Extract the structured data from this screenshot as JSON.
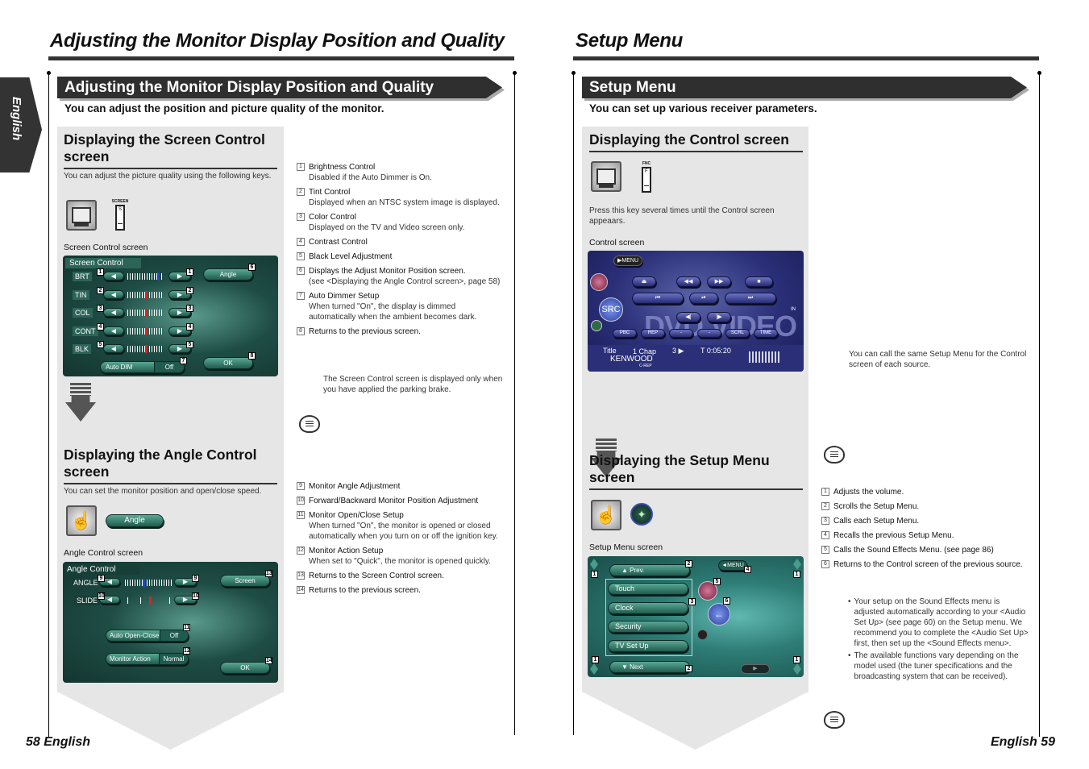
{
  "left_page": {
    "title": "Adjusting the Monitor Display Position and Quality",
    "side_tab": "English",
    "banner": "Adjusting the Monitor Display Position and Quality",
    "lead": "You can adjust the position and picture quality of the monitor.",
    "section1": {
      "heading": "Displaying the Screen Control screen",
      "intro": "You can adjust the picture quality using the following keys.",
      "key_label": "SCREEN",
      "key_letter": "S",
      "caption": "Screen Control screen",
      "screen": {
        "title": "Screen Control",
        "rows": [
          {
            "label": "BRT",
            "num": "1",
            "level": 0.85,
            "marker_color": "#2244cc"
          },
          {
            "label": "TIN",
            "num": "2",
            "level": 0.5,
            "marker_color": "#dd2222"
          },
          {
            "label": "COL",
            "num": "3",
            "level": 0.5,
            "marker_color": "#dd2222"
          },
          {
            "label": "CONT",
            "num": "4",
            "level": 0.5,
            "marker_color": "#dd2222"
          },
          {
            "label": "BLK",
            "num": "5",
            "level": 0.5,
            "marker_color": "#dd2222"
          }
        ],
        "angle_button": "Angle",
        "angle_num": "6",
        "auto_dim_label": "Auto DIM",
        "auto_dim_value": "Off",
        "auto_dim_num": "7",
        "ok_button": "OK",
        "ok_num": "8"
      },
      "items": [
        {
          "num": "1",
          "title": "Brightness Control",
          "desc": "Disabled if the Auto Dimmer is On."
        },
        {
          "num": "2",
          "title": "Tint Control",
          "desc": "Displayed when an NTSC system image is displayed."
        },
        {
          "num": "3",
          "title": "Color Control",
          "desc": "Displayed on the TV and Video screen only."
        },
        {
          "num": "4",
          "title": "Contrast Control",
          "desc": ""
        },
        {
          "num": "5",
          "title": "Black Level Adjustment",
          "desc": ""
        },
        {
          "num": "6",
          "title": "Displays the Adjust Monitor Position screen.",
          "desc": "(see <Displaying the Angle Control screen>, page 58)"
        },
        {
          "num": "7",
          "title": "Auto Dimmer Setup",
          "desc": "When turned \"On\", the display is dimmed automatically when the ambient becomes dark."
        },
        {
          "num": "8",
          "title": "Returns to the previous screen.",
          "desc": ""
        }
      ],
      "note": "The Screen Control screen is displayed only when you have applied the parking brake."
    },
    "section2": {
      "heading": "Displaying the Angle Control screen",
      "intro": "You can set the monitor position and open/close speed.",
      "key_button": "Angle",
      "caption": "Angle Control screen",
      "screen": {
        "title": "Angle Control",
        "angle_label": "ANGLE",
        "angle_num": "9",
        "angle_level": 0.4,
        "slide_label": "SLIDE",
        "slide_num": "10",
        "slide_level": 0.5,
        "screen_button": "Screen",
        "screen_num": "13",
        "auto_open_label": "Auto Open-Close",
        "auto_open_value": "Off",
        "auto_open_num": "11",
        "monitor_action_label": "Monitor Action",
        "monitor_action_value": "Normal",
        "monitor_action_num": "12",
        "ok_button": "OK",
        "ok_num": "14"
      },
      "items": [
        {
          "num": "9",
          "title": "Monitor Angle Adjustment",
          "desc": ""
        },
        {
          "num": "10",
          "title": "Forward/Backward Monitor Position Adjustment",
          "desc": ""
        },
        {
          "num": "11",
          "title": "Monitor Open/Close Setup",
          "desc": "When turned \"On\", the monitor is opened or closed automatically when you turn on or off the ignition key."
        },
        {
          "num": "12",
          "title": "Monitor Action Setup",
          "desc": "When set to \"Quick\", the monitor is opened quickly."
        },
        {
          "num": "13",
          "title": "Returns to the Screen Control screen.",
          "desc": ""
        },
        {
          "num": "14",
          "title": "Returns to the previous screen.",
          "desc": ""
        }
      ]
    },
    "footer": "58 English"
  },
  "right_page": {
    "title": "Setup Menu",
    "banner": "Setup Menu",
    "lead": "You can set up various receiver parameters.",
    "section1": {
      "heading": "Displaying the Control screen",
      "key_label": "FNC",
      "key_letter": "F",
      "intro": "Press this key several times until the Control screen appeaars.",
      "caption": "Control screen",
      "screen": {
        "menu_button": "▶MENU",
        "src_button": "SRC",
        "watermark": "DVD VIDEO",
        "in_label": "IN",
        "small_buttons": [
          "PBC",
          "REP",
          "-",
          "-",
          "SCRL",
          "TIME"
        ],
        "title_label": "Title",
        "chap": "1 Chap",
        "track": "3",
        "time": "T 0:05:20",
        "brand": "KENWOOD",
        "crep": "C-REP"
      },
      "note": "You can call the same Setup Menu for the Control screen of each source."
    },
    "section2": {
      "heading": "Displaying the Setup Menu screen",
      "caption": "Setup Menu screen",
      "screen": {
        "prev_button": "▲ Prev.",
        "next_button": "▼ Next",
        "menu_button": "◄MENU",
        "menu_items": [
          "Touch",
          "Clock",
          "Security",
          "TV Set Up"
        ],
        "nums": {
          "volume": "1",
          "scroll": "2",
          "list": "3",
          "menu": "4",
          "sound": "5",
          "return": "6"
        }
      },
      "items": [
        {
          "num": "1",
          "title": "Adjusts the volume."
        },
        {
          "num": "2",
          "title": "Scrolls the Setup Menu."
        },
        {
          "num": "3",
          "title": "Calls each Setup Menu."
        },
        {
          "num": "4",
          "title": "Recalls the previous Setup Menu."
        },
        {
          "num": "5",
          "title": "Calls the Sound Effects Menu. (see page 86)"
        },
        {
          "num": "6",
          "title": "Returns to the Control screen of the previous source."
        }
      ],
      "notes": [
        "Your setup on the Sound Effects menu is adjusted automatically according to your <Audio Set Up> (see page 60) on the Setup menu. We recommend you to complete the <Audio Set Up> first, then set up the <Sound Effects menu>.",
        "The available functions vary depending on the model used (the tuner specifications and the broadcasting system that can be received)."
      ]
    },
    "footer": "English 59"
  }
}
